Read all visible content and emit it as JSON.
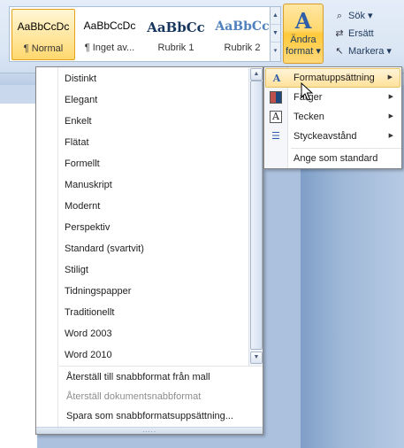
{
  "ribbon": {
    "styles": [
      {
        "sample": "AaBbCcDc",
        "name": "¶ Normal"
      },
      {
        "sample": "AaBbCcDc",
        "name": "¶ Inget av..."
      },
      {
        "sample": "AaBbCc",
        "name": "Rubrik 1"
      },
      {
        "sample": "AaBbCc",
        "name": "Rubrik 2"
      }
    ],
    "change_styles": {
      "line1": "Ändra",
      "line2": "format ▾"
    },
    "editing": {
      "find": "Sök ▾",
      "replace": "Ersätt",
      "select": "Markera ▾"
    }
  },
  "dropdown": {
    "items": [
      "Distinkt",
      "Elegant",
      "Enkelt",
      "Flätat",
      "Formellt",
      "Manuskript",
      "Modernt",
      "Perspektiv",
      "Standard (svartvit)",
      "Stiligt",
      "Tidningspapper",
      "Traditionellt",
      "Word 2003",
      "Word 2010"
    ],
    "commands": [
      {
        "label": "Återställ till snabbformat från mall",
        "disabled": false
      },
      {
        "label": "Återställ dokumentsnabbformat",
        "disabled": true
      },
      {
        "label": "Spara som snabbformatsuppsättning...",
        "disabled": false
      }
    ],
    "grip": "....."
  },
  "submenu": {
    "items": [
      {
        "label": "Formatuppsättning",
        "icon": "style-set-icon",
        "has_submenu": true
      },
      {
        "label": "Färger",
        "icon": "colors-icon",
        "has_submenu": true
      },
      {
        "label": "Tecken",
        "icon": "fonts-icon",
        "has_submenu": true
      },
      {
        "label": "Styckeavstånd",
        "icon": "paragraph-spacing-icon",
        "has_submenu": true
      },
      {
        "label": "Ange som standard",
        "icon": "",
        "has_submenu": false
      }
    ]
  },
  "colors": {
    "highlight": "#ffe19a",
    "accent": "#2f5fa8"
  }
}
